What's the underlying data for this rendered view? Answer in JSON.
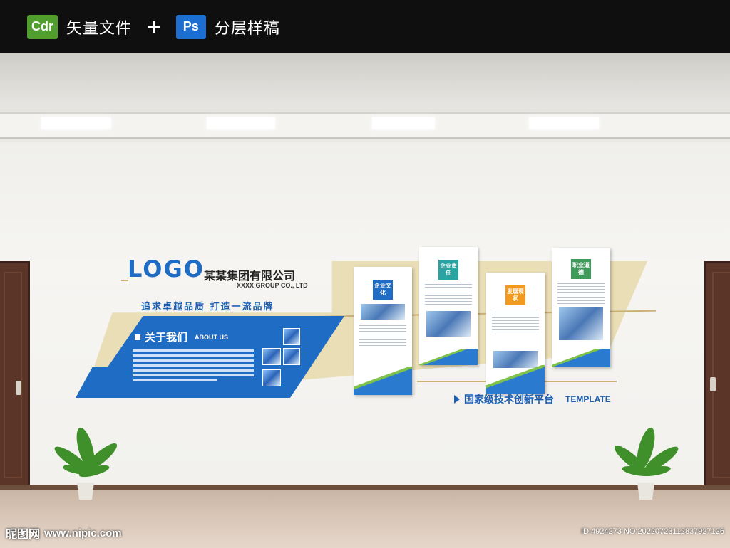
{
  "header": {
    "cdr_badge": "Cdr",
    "cdr_text": "矢量文件",
    "plus": "+",
    "ps_badge": "Ps",
    "ps_text": "分层样稿"
  },
  "wall": {
    "logo": "LOGO",
    "company_name": "某某集团有限公司",
    "company_en": "XXXX GROUP CO., LTD",
    "slogan": "追求卓越品质  打造一流品牌",
    "about_title": "关于我们",
    "about_en": "ABOUT US",
    "boards": [
      {
        "tag": "企业文化",
        "color": "#1f6cc4"
      },
      {
        "tag": "企业责任",
        "color": "#2aa3a3"
      },
      {
        "tag": "发展现状",
        "color": "#f29a1f"
      },
      {
        "tag": "职业道德",
        "color": "#3f9a5a"
      }
    ],
    "platform_text": "国家级技术创新平台",
    "template_text": "TEMPLATE"
  },
  "watermark": {
    "site_cn": "昵图网",
    "site_url": "www.nipic.com",
    "id_text": "ID:4924273 NO:20220723112837927126"
  }
}
